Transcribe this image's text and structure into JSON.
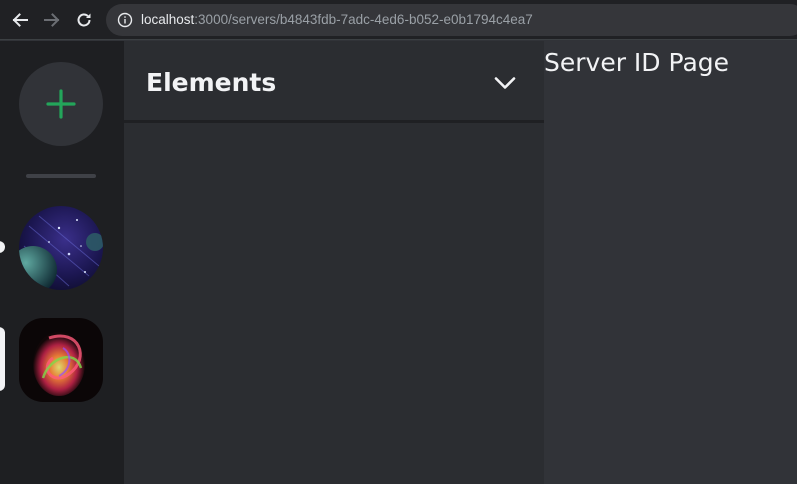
{
  "browser": {
    "url_host": "localhost",
    "url_path": ":3000/servers/b4843fdb-7adc-4ed6-b052-e0b1794c4ea7",
    "back_icon": "arrow-left-icon",
    "forward_icon": "arrow-right-icon",
    "reload_icon": "reload-icon",
    "info_icon": "info-icon"
  },
  "server_rail": {
    "add_icon": "plus-icon",
    "add_color": "#23a55a",
    "servers": [
      {
        "icon": "space-planet-image",
        "active": false
      },
      {
        "icon": "abstract-swirl-image",
        "active": true
      }
    ]
  },
  "channel_panel": {
    "server_name": "Elements",
    "dropdown_icon": "chevron-down-icon"
  },
  "main": {
    "title": "Server ID Page"
  }
}
